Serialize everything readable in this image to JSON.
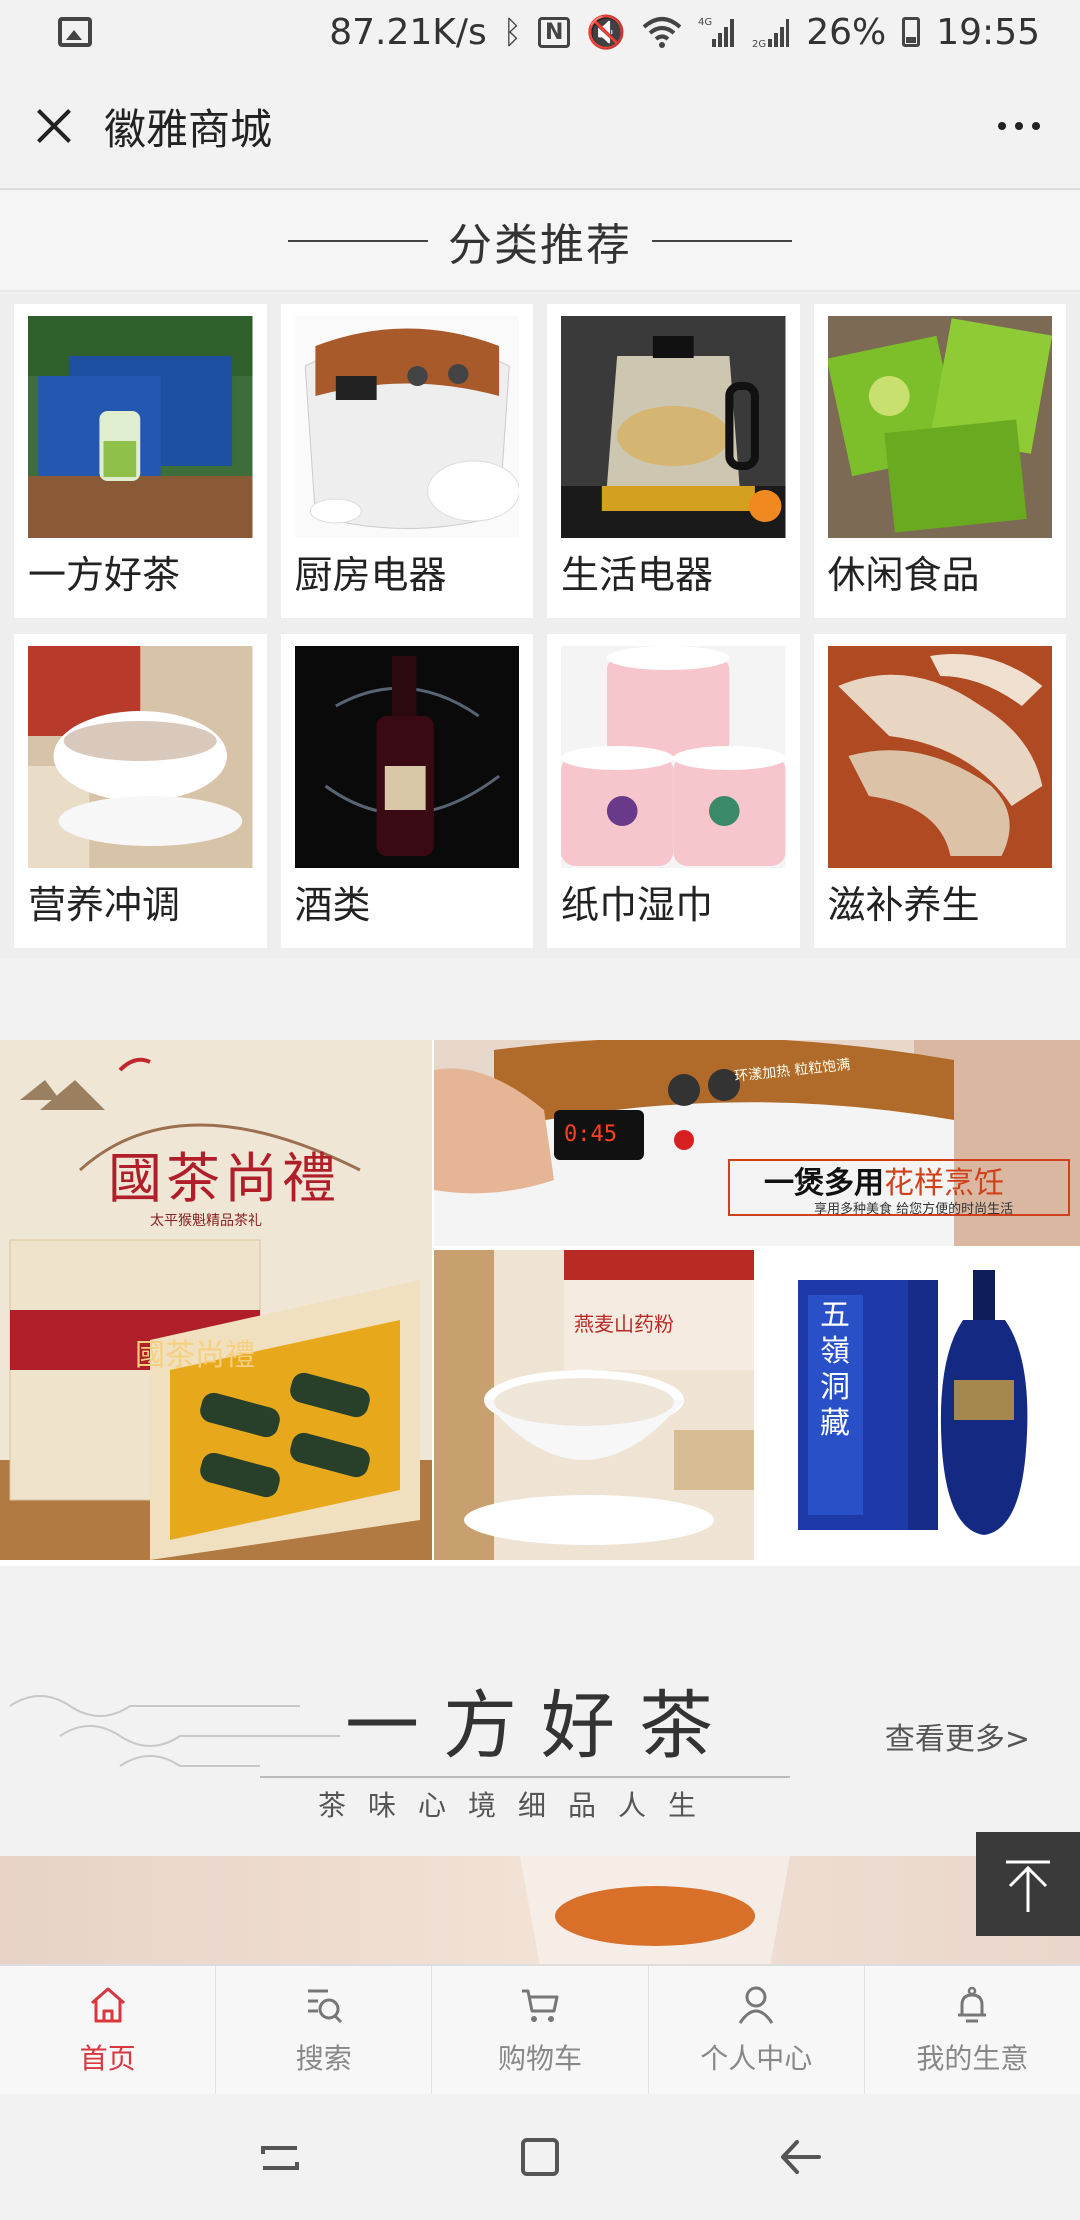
{
  "status_bar": {
    "speed": "87.21K/s",
    "battery": "26%",
    "time": "19:55",
    "icons": [
      "image-icon",
      "bluetooth-icon",
      "nfc-icon",
      "mute-icon",
      "wifi-icon",
      "signal-4g-icon",
      "signal-2g-icon",
      "battery-icon"
    ]
  },
  "header": {
    "title": "徽雅商城"
  },
  "section": {
    "title": "分类推荐"
  },
  "categories": [
    {
      "label": "一方好茶"
    },
    {
      "label": "厨房电器"
    },
    {
      "label": "生活电器"
    },
    {
      "label": "休闲食品"
    },
    {
      "label": "营养冲调"
    },
    {
      "label": "酒类"
    },
    {
      "label": "纸巾湿巾"
    },
    {
      "label": "滋补养生"
    }
  ],
  "banners": {
    "tea": {
      "title": "國茶尚禮",
      "subtitle": "太平猴魁精品茶礼",
      "box_text": "國茶尚禮"
    },
    "cooker": {
      "slogan_a": "一煲多用",
      "slogan_b": "花样烹饪",
      "small": "享用多种美食 给您方便的时尚生活",
      "top_text": "环漾加热 粒粒饱满",
      "display": "0:45"
    },
    "powder": {
      "label": "燕麦山药粉"
    },
    "liquor": {
      "name": "五嶺洞藏"
    }
  },
  "tea_section": {
    "title": "一方好茶",
    "subtitle": "茶味心境细品人生",
    "more": "查看更多>"
  },
  "tabs": [
    {
      "label": "首页",
      "icon": "home-icon",
      "active": true
    },
    {
      "label": "搜索",
      "icon": "search-icon",
      "active": false
    },
    {
      "label": "购物车",
      "icon": "cart-icon",
      "active": false
    },
    {
      "label": "个人中心",
      "icon": "user-icon",
      "active": false
    },
    {
      "label": "我的生意",
      "icon": "business-icon",
      "active": false
    }
  ],
  "colors": {
    "accent": "#d9363e",
    "tab_inactive": "#888888",
    "background": "#f2f2f2"
  }
}
